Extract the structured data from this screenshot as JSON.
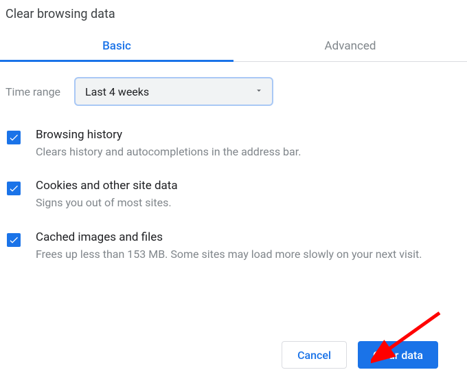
{
  "dialog": {
    "title": "Clear browsing data"
  },
  "tabs": {
    "basic": "Basic",
    "advanced": "Advanced",
    "active": "basic"
  },
  "time_range": {
    "label": "Time range",
    "value": "Last 4 weeks"
  },
  "options": [
    {
      "title": "Browsing history",
      "description": "Clears history and autocompletions in the address bar.",
      "checked": true
    },
    {
      "title": "Cookies and other site data",
      "description": "Signs you out of most sites.",
      "checked": true
    },
    {
      "title": "Cached images and files",
      "description": "Frees up less than 153 MB. Some sites may load more slowly on your next visit.",
      "checked": true
    }
  ],
  "buttons": {
    "cancel": "Cancel",
    "clear": "Clear data"
  },
  "colors": {
    "accent": "#1a73e8",
    "muted": "#80868b",
    "border": "#dadce0"
  }
}
